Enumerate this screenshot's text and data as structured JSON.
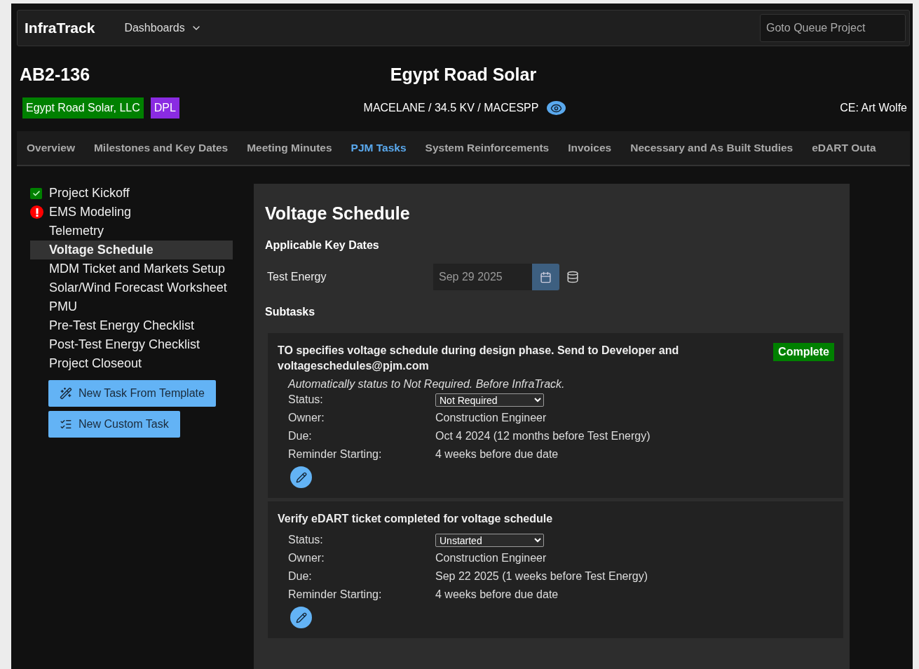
{
  "navbar": {
    "brand": "InfraTrack",
    "menu": {
      "label": "Dashboards"
    },
    "search": {
      "placeholder": "Goto Queue Project"
    }
  },
  "project": {
    "id": "AB2-136",
    "title": "Egypt Road Solar",
    "tags": [
      {
        "label": "Egypt Road Solar, LLC",
        "color": "#008000"
      },
      {
        "label": "DPL",
        "color": "#8a2be2"
      }
    ],
    "route": "MACELANE / 34.5 KV / MACESPP",
    "engineer": "CE: Art Wolfe"
  },
  "tabs": [
    {
      "label": "Overview",
      "selected": false
    },
    {
      "label": "Milestones and Key Dates",
      "selected": false
    },
    {
      "label": "Meeting Minutes",
      "selected": false
    },
    {
      "label": "PJM Tasks",
      "selected": true
    },
    {
      "label": "System Reinforcements",
      "selected": false
    },
    {
      "label": "Invoices",
      "selected": false
    },
    {
      "label": "Necessary and As Built Studies",
      "selected": false
    },
    {
      "label": "eDART Outa",
      "selected": false
    }
  ],
  "sidebar": {
    "items": [
      {
        "label": "Project Kickoff",
        "done": true,
        "warning": false,
        "selected": false
      },
      {
        "label": "EMS Modeling",
        "done": false,
        "warning": true,
        "selected": false
      },
      {
        "label": "Telemetry",
        "done": false,
        "warning": false,
        "selected": false
      },
      {
        "label": "Voltage Schedule",
        "done": false,
        "warning": false,
        "selected": true
      },
      {
        "label": "MDM Ticket and Markets Setup",
        "done": false,
        "warning": false,
        "selected": false
      },
      {
        "label": "Solar/Wind Forecast Worksheet",
        "done": false,
        "warning": false,
        "selected": false
      },
      {
        "label": "PMU",
        "done": false,
        "warning": false,
        "selected": false
      },
      {
        "label": "Pre-Test Energy Checklist",
        "done": false,
        "warning": false,
        "selected": false
      },
      {
        "label": "Post-Test Energy Checklist",
        "done": false,
        "warning": false,
        "selected": false
      },
      {
        "label": "Project Closeout",
        "done": false,
        "warning": false,
        "selected": false
      }
    ],
    "buttons": [
      {
        "label": "New Task From Template",
        "kind": "template"
      },
      {
        "label": "New Custom Task",
        "kind": "custom"
      }
    ]
  },
  "task": {
    "title": "Voltage Schedule",
    "key_dates_heading": "Applicable Key Dates",
    "key_dates": [
      {
        "label": "Test Energy",
        "value": "Sep 29 2025"
      }
    ],
    "subtasks_heading": "Subtasks",
    "subtasks": [
      {
        "title": "TO specifies voltage schedule during design phase. Send to Developer and voltageschedules@pjm.com",
        "badge": "Complete",
        "note": "Automatically status to Not Required. Before InfraTrack.",
        "fields": [
          {
            "label": "Status:",
            "kind": "select",
            "value": "Not Required"
          },
          {
            "label": "Owner:",
            "kind": "text",
            "value": "Construction Engineer"
          },
          {
            "label": "Due:",
            "kind": "text",
            "value": "Oct 4 2024 (12 months before Test Energy)"
          },
          {
            "label": "Reminder Starting:",
            "kind": "text",
            "value": "4 weeks before due date"
          }
        ]
      },
      {
        "title": "Verify eDART ticket completed for voltage schedule",
        "fields": [
          {
            "label": "Status:",
            "kind": "select",
            "value": "Unstarted"
          },
          {
            "label": "Owner:",
            "kind": "text",
            "value": "Construction Engineer"
          },
          {
            "label": "Due:",
            "kind": "text",
            "value": "Sep 22 2025 (1 weeks before Test Energy)"
          },
          {
            "label": "Reminder Starting:",
            "kind": "text",
            "value": "4 weeks before due date"
          }
        ]
      }
    ]
  }
}
